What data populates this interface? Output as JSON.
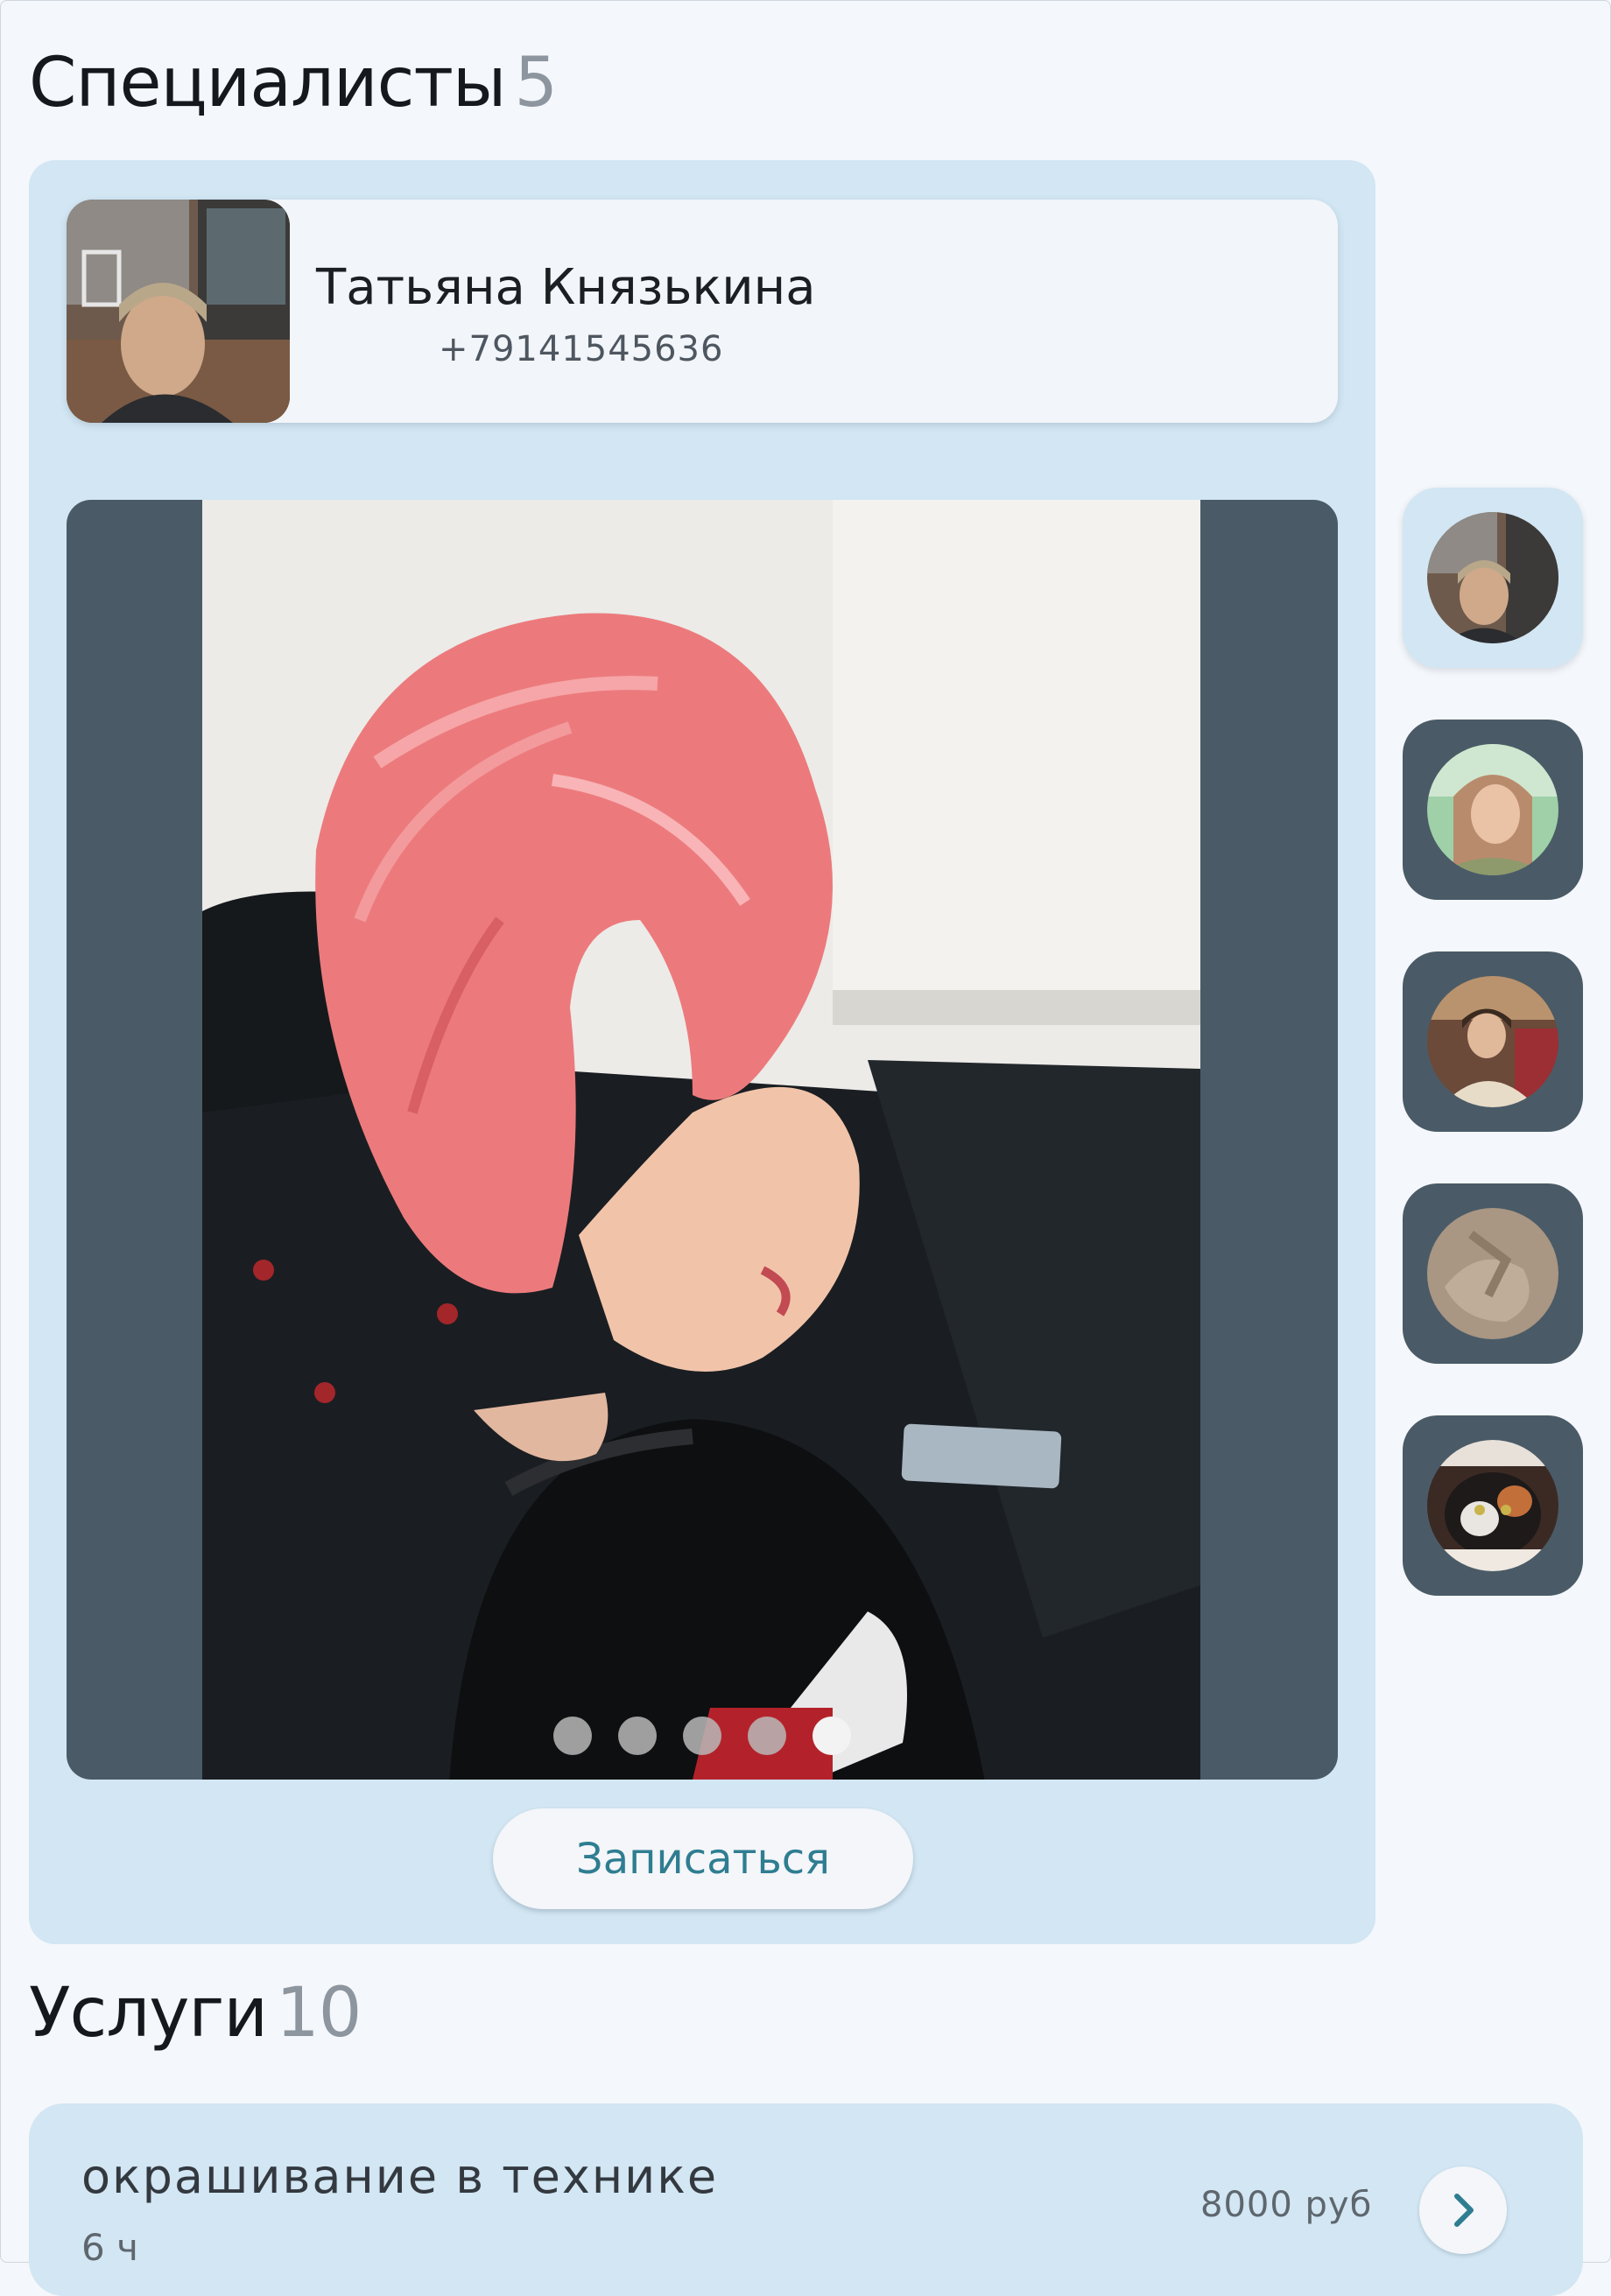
{
  "specialists_section": {
    "title": "Специалисты",
    "count": "5"
  },
  "selected_specialist": {
    "name": "Татьяна Князькина",
    "phone": "+79141545636",
    "gallery": {
      "photo_count": 5,
      "active_index": 4
    },
    "book_label": "Записаться"
  },
  "specialist_thumbnails": [
    {
      "icon": "avatar-photo",
      "active": true
    },
    {
      "icon": "avatar-photo",
      "active": false
    },
    {
      "icon": "avatar-photo",
      "active": false
    },
    {
      "icon": "avatar-photo",
      "active": false
    },
    {
      "icon": "avatar-photo",
      "active": false
    }
  ],
  "services_section": {
    "title": "Услуги",
    "count": "10"
  },
  "services": [
    {
      "name": "окрашивание в технике",
      "duration": "6 ч",
      "price": "8000 руб",
      "icon": "chevron-right-icon"
    }
  ],
  "colors": {
    "page_bg": "#f4f7fb",
    "panel_bg": "#d2e6f3",
    "gallery_bg": "#4a5b67",
    "accent_text": "#2f7d91",
    "muted_count": "#8d959e"
  }
}
